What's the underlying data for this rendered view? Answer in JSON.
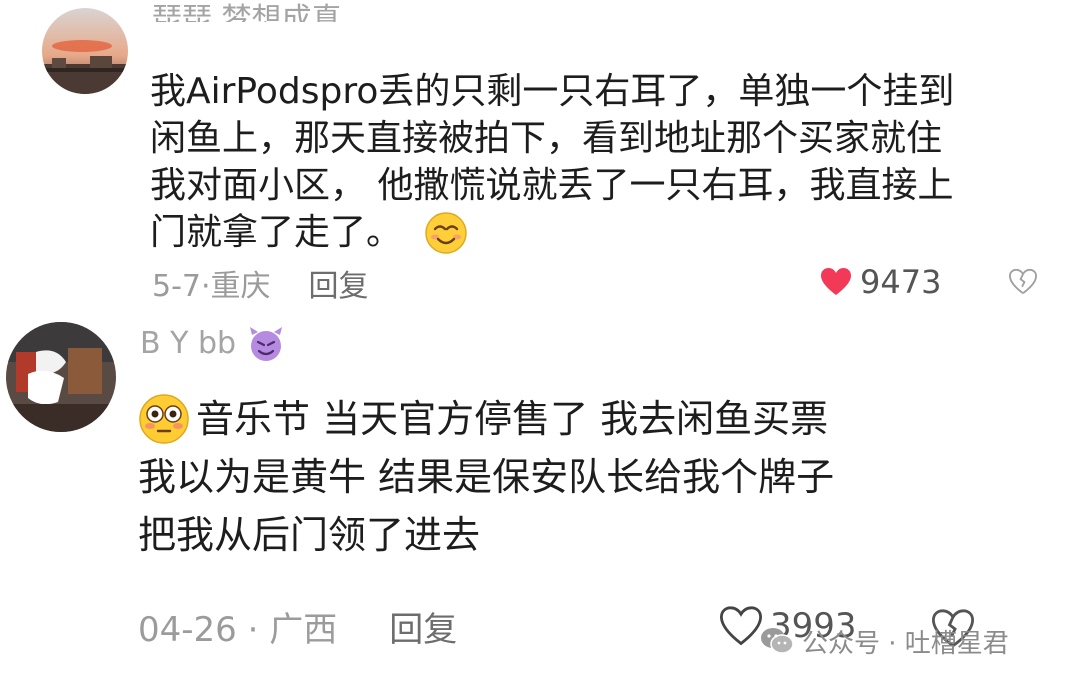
{
  "comments": [
    {
      "username": "琵琵 梦想成真",
      "content_lines": [
        "我AirPodspro丢的只剩一只右耳了，单独一个挂到",
        "闲鱼上，那天直接被拍下，看到地址那个买家就住",
        "我对面小区， 他撒慌说就丢了一只右耳，我直接上",
        "门就拿了走了。"
      ],
      "emoji": "smiling-face-emoji",
      "date_location": "5-7·重庆",
      "reply_label": "回复",
      "likes": "9473",
      "liked": true,
      "like_color": "#f23a58"
    },
    {
      "username": "B Y bb",
      "username_badge": "devil-emoji",
      "content_lines": [
        "音乐节 当天官方停售了 我去闲鱼买票",
        "我以为是黄牛 结果是保安队长给我个牌子",
        "把我从后门领了进去"
      ],
      "emoji": "flushed-face-emoji",
      "date_location": "04-26 · 广西",
      "reply_label": "回复",
      "likes": "3993",
      "liked": false
    }
  ],
  "watermark": {
    "icon": "wechat-official-account-icon",
    "text": "公众号 · 吐槽星君"
  }
}
